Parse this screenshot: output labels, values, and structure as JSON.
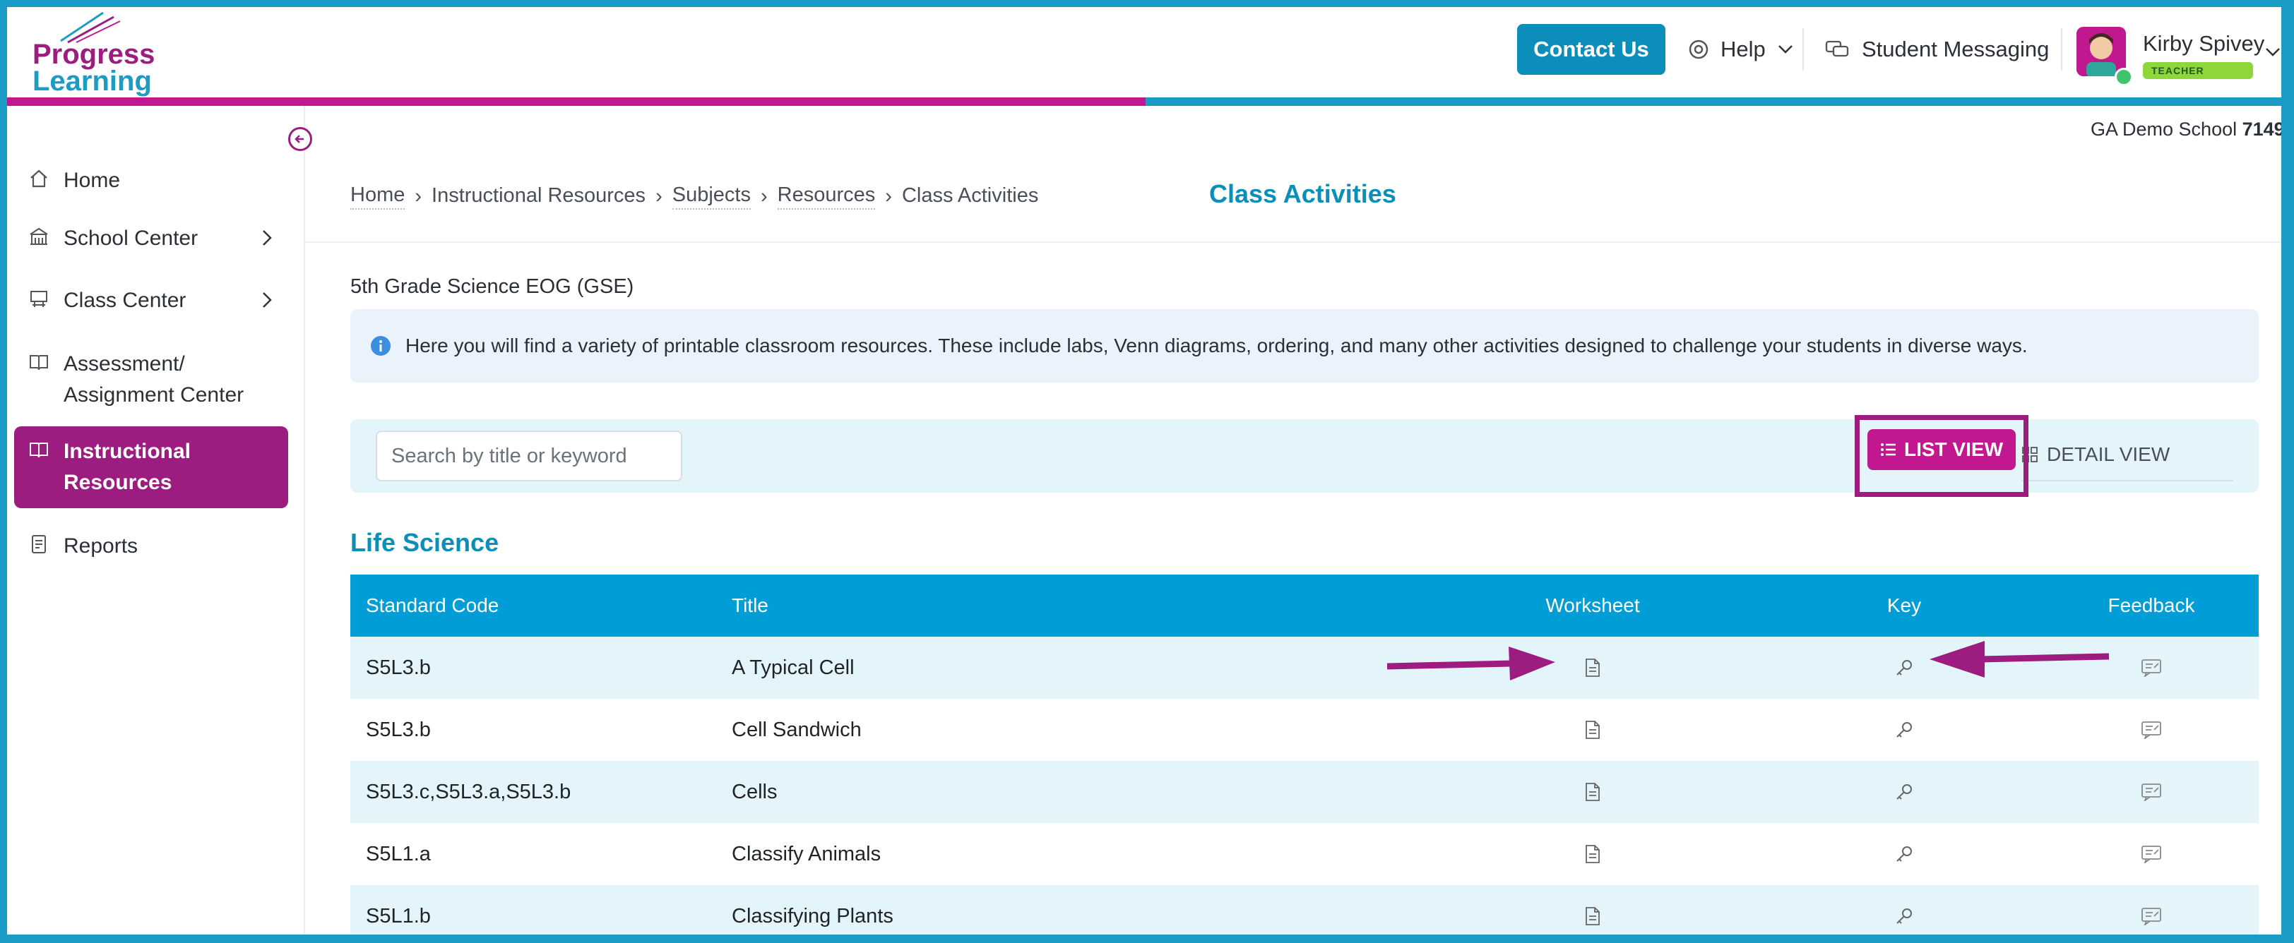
{
  "brand": {
    "line1": "Progress",
    "line2": "Learning",
    "colors": {
      "magenta": "#9c1d7f",
      "blue": "#1a9cc6"
    }
  },
  "header": {
    "contact_label": "Contact Us",
    "help_label": "Help",
    "messaging_label": "Student Messaging",
    "user_name": "Kirby Spivey",
    "user_role": "TEACHER"
  },
  "school": {
    "name": "GA Demo School",
    "id": "7149"
  },
  "sidebar": {
    "items": [
      {
        "label": "Home",
        "icon": "home-icon"
      },
      {
        "label": "School Center",
        "icon": "school-icon"
      },
      {
        "label": "Class Center",
        "icon": "class-icon"
      },
      {
        "label": "Assessment/ Assignment Center",
        "icon": "book-icon"
      },
      {
        "label": "Instructional Resources",
        "icon": "open-book-icon"
      },
      {
        "label": "Reports",
        "icon": "report-icon"
      }
    ]
  },
  "breadcrumb": [
    "Home",
    "Instructional Resources",
    "Subjects",
    "Resources",
    "Class Activities"
  ],
  "page_title": "Class Activities",
  "course": "5th Grade Science EOG (GSE)",
  "info_text": "Here you will find a variety of printable classroom resources. These include labs, Venn diagrams, ordering, and many other activities designed to challenge your students in diverse ways.",
  "search": {
    "placeholder": "Search by title or keyword"
  },
  "views": {
    "list": "LIST VIEW",
    "detail": "DETAIL VIEW"
  },
  "section_title": "Life Science",
  "table": {
    "headers": [
      "Standard Code",
      "Title",
      "Worksheet",
      "Key",
      "Feedback"
    ],
    "rows": [
      {
        "code": "S5L3.b",
        "title": "A Typical Cell"
      },
      {
        "code": "S5L3.b",
        "title": "Cell Sandwich"
      },
      {
        "code": "S5L3.c,S5L3.a,S5L3.b",
        "title": "Cells"
      },
      {
        "code": "S5L1.a",
        "title": "Classify Animals"
      },
      {
        "code": "S5L1.b",
        "title": "Classifying Plants"
      }
    ]
  }
}
